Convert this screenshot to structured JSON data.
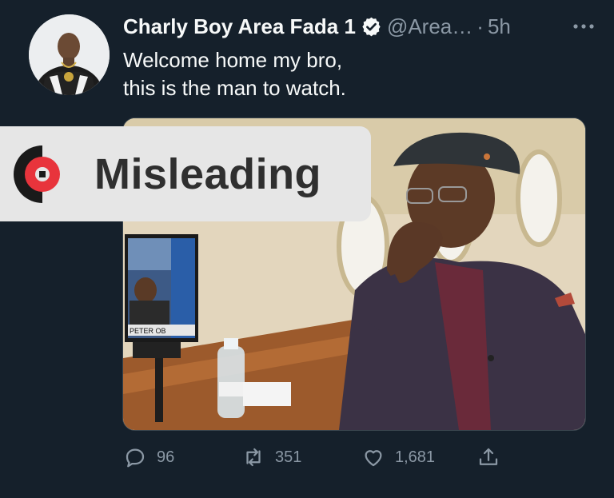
{
  "tweet": {
    "author_name": "Charly Boy Area Fada 1",
    "handle": "@Area…",
    "separator": "·",
    "time": "5h",
    "text_lines": [
      "Welcome home my bro,",
      "this is the man to watch."
    ]
  },
  "media": {
    "tv_caption": "PETER OB"
  },
  "factcheck": {
    "label": "Misleading",
    "color": "#2f2f2f",
    "logo_color": "#e8343c"
  },
  "actions": {
    "replies": "96",
    "retweets": "351",
    "likes": "1,681"
  },
  "icons": [
    "verified-badge-icon",
    "more-icon",
    "reply-icon",
    "retweet-icon",
    "like-icon",
    "share-icon"
  ],
  "colors": {
    "background": "#15202b",
    "text": "#f7f9f9",
    "muted": "#8b98a5"
  }
}
